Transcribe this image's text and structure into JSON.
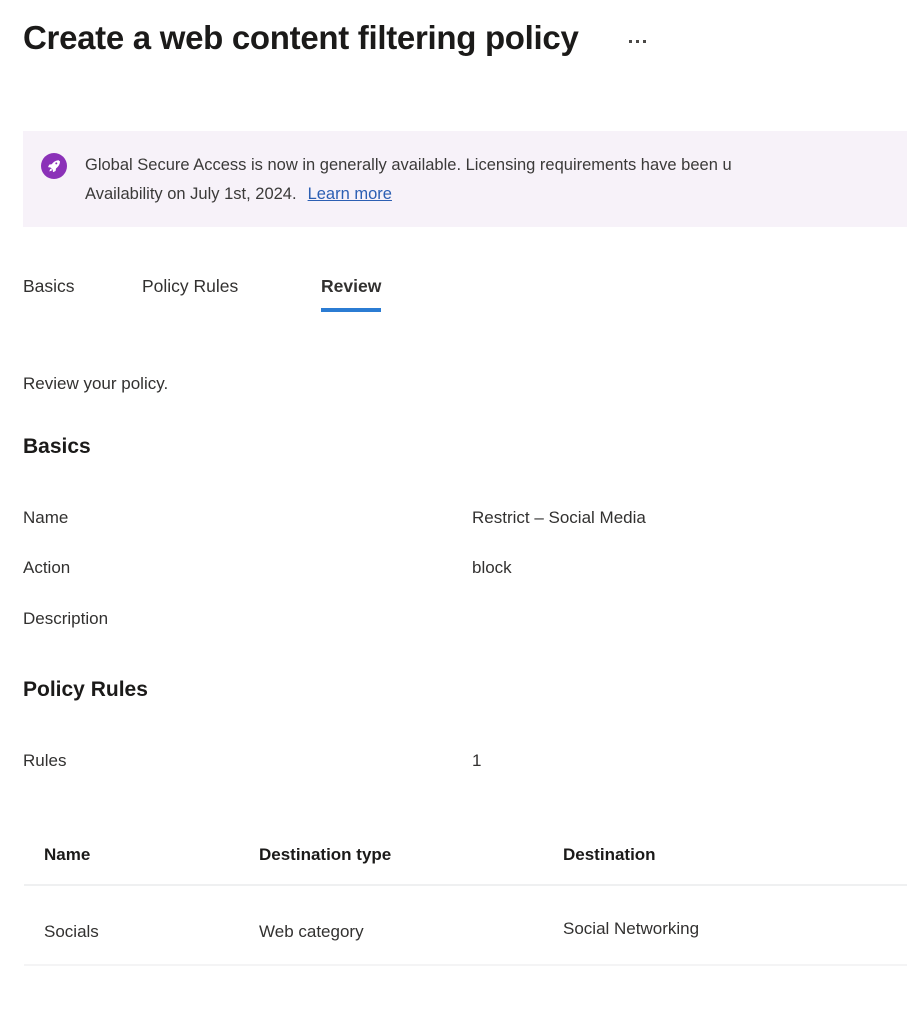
{
  "header": {
    "title": "Create a web content filtering policy",
    "more_menu_icon": "ellipsis-horizontal-icon"
  },
  "banner": {
    "icon": "rocket-icon",
    "line1": "Global Secure Access is now in generally available. Licensing requirements have been u",
    "line2": "Availability on July 1st, 2024.",
    "link_label": "Learn more",
    "background": "#f7f2f9",
    "icon_color": "#8b31b8",
    "link_color": "#2c5fb3"
  },
  "tabs": {
    "active_color": "#2b7cd3",
    "items": [
      {
        "label": "Basics",
        "active": false
      },
      {
        "label": "Policy Rules",
        "active": false
      },
      {
        "label": "Review",
        "active": true
      }
    ]
  },
  "main": {
    "intro": "Review your policy.",
    "basics": {
      "heading": "Basics",
      "rows": [
        {
          "label": "Name",
          "value": "Restrict – Social Media"
        },
        {
          "label": "Action",
          "value": "block"
        },
        {
          "label": "Description",
          "value": ""
        }
      ]
    },
    "policy_rules": {
      "heading": "Policy Rules",
      "rows": [
        {
          "label": "Rules",
          "value": "1"
        }
      ],
      "table": {
        "columns": [
          "Name",
          "Destination type",
          "Destination"
        ],
        "rows": [
          {
            "name": "Socials",
            "destination_type": "Web category",
            "destination": "Social Networking"
          }
        ]
      }
    }
  }
}
